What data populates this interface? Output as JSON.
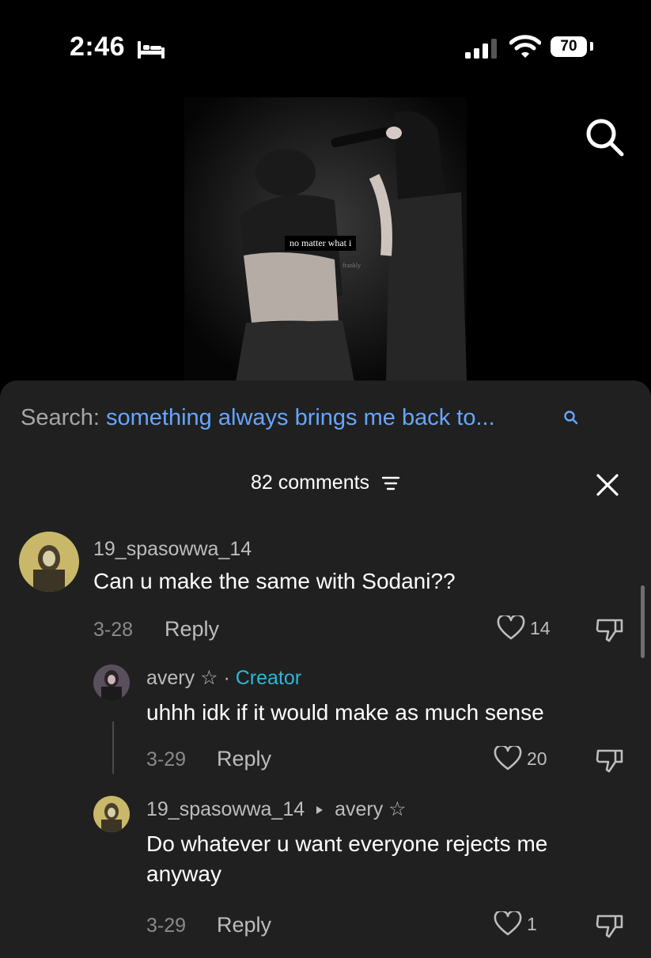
{
  "status_bar": {
    "time": "2:46",
    "battery": "70"
  },
  "video": {
    "caption": "no matter what i",
    "watermark": "frankly"
  },
  "search": {
    "prefix": "Search:",
    "query": "something always brings me back to..."
  },
  "comments": {
    "count_label": "82 comments"
  },
  "thread": [
    {
      "username": "19_spasowwa_14",
      "text": "Can u make the same with Sodani??",
      "date": "3-28",
      "reply": "Reply",
      "likes": "14"
    },
    {
      "username": "avery ☆",
      "separator": "·",
      "badge": "Creator",
      "text": "uhhh idk if it would make as much sense",
      "date": "3-29",
      "reply": "Reply",
      "likes": "20"
    },
    {
      "username": "19_spasowwa_14",
      "reply_to": "avery ☆",
      "text": "Do whatever u want everyone rejects me anyway",
      "date": "3-29",
      "reply": "Reply",
      "likes": "1"
    }
  ],
  "colors": {
    "background": "#000000",
    "sheet": "#202020",
    "link_blue": "#66a6ff",
    "creator_teal": "#2fb6d8"
  }
}
